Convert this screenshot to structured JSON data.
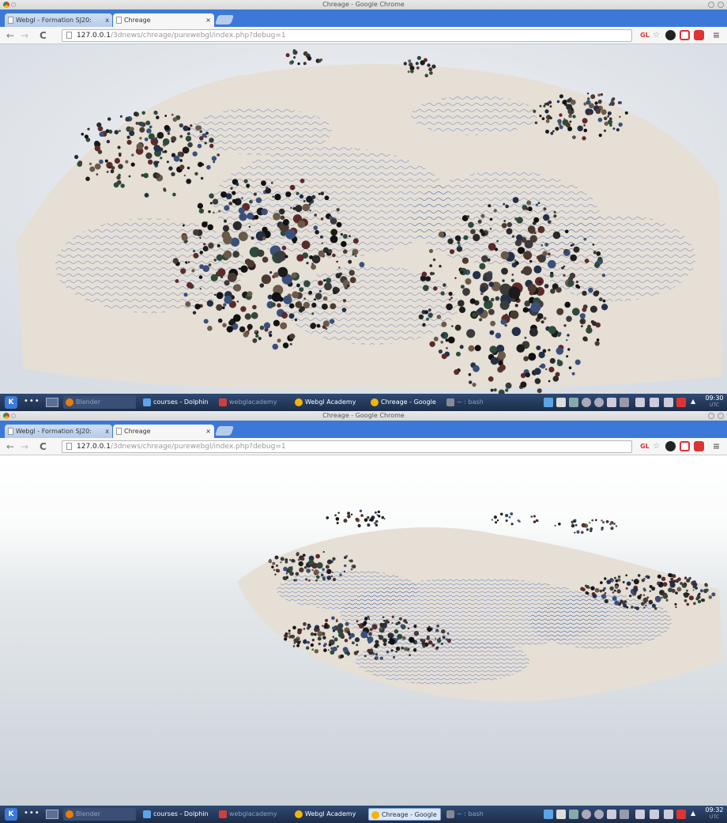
{
  "screenshots": [
    {
      "window_title": "Chreage - Google Chrome",
      "tabs": [
        {
          "label": "Webgl - Formation SJ20:",
          "active": false
        },
        {
          "label": "Chreage",
          "active": true
        }
      ],
      "url_host": "127.0.0.1",
      "url_path": "/3dnews/chreage/purewebgl/index.php?debug=1",
      "extensions": [
        "GL"
      ],
      "taskbar": {
        "items": [
          {
            "label": "Blender",
            "dim": true,
            "active": false
          },
          {
            "label": "courses - Dolphin",
            "dim": false,
            "active": false
          },
          {
            "label": "webglacademy",
            "dim": true,
            "active": false
          },
          {
            "label": "Webgl Academy",
            "dim": false,
            "active": false
          },
          {
            "label": "Chreage - Google",
            "dim": false,
            "active": false
          },
          {
            "label": "~ : bash",
            "dim": true,
            "active": false
          }
        ],
        "clock": "09:30",
        "timezone": "UTC"
      }
    },
    {
      "window_title": "Chreage - Google Chrome",
      "tabs": [
        {
          "label": "Webgl - Formation SJ20:",
          "active": false
        },
        {
          "label": "Chreage",
          "active": true
        }
      ],
      "url_host": "127.0.0.1",
      "url_path": "/3dnews/chreage/purewebgl/index.php?debug=1",
      "extensions": [
        "GL"
      ],
      "taskbar": {
        "items": [
          {
            "label": "Blender",
            "dim": true,
            "active": false
          },
          {
            "label": "courses - Dolphin",
            "dim": false,
            "active": false
          },
          {
            "label": "webglacademy",
            "dim": true,
            "active": false
          },
          {
            "label": "Webgl Academy",
            "dim": false,
            "active": false
          },
          {
            "label": "Chreage - Google",
            "dim": false,
            "active": true
          },
          {
            "label": "~ : bash",
            "dim": true,
            "active": false
          }
        ],
        "clock": "09:32",
        "timezone": "UTC"
      }
    }
  ],
  "colors": {
    "tabstrip": "#3b78d8",
    "taskbar": "#2f4a73",
    "terrain": "#e6dfd6",
    "terrain_pattern": "#4d74b8"
  },
  "icons": [
    "back-arrow-icon",
    "forward-arrow-icon",
    "reload-icon",
    "page-icon",
    "bookmark-star-icon",
    "chrome-menu-icon",
    "kde-launcher-icon"
  ]
}
